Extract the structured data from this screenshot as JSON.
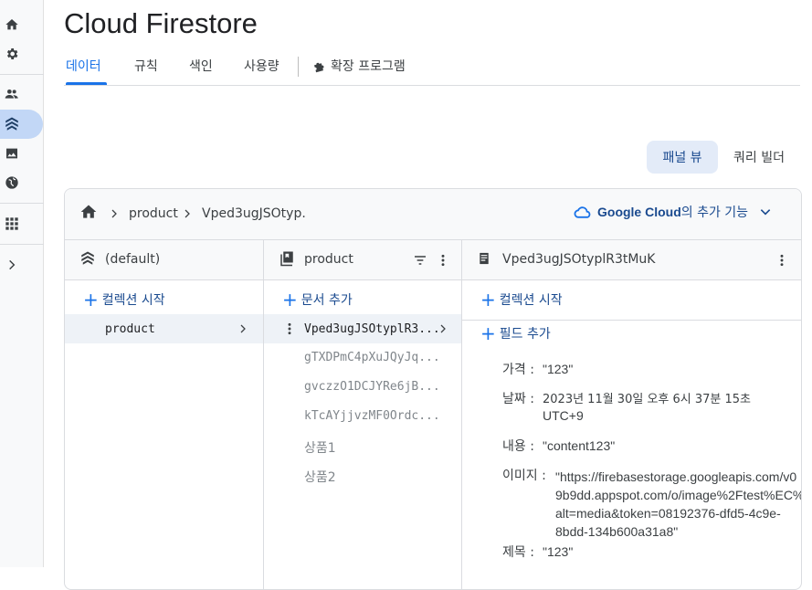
{
  "app": {
    "title": "Cloud Firestore"
  },
  "tabs": [
    {
      "label": "데이터",
      "active": true
    },
    {
      "label": "규칙"
    },
    {
      "label": "색인"
    },
    {
      "label": "사용량"
    },
    {
      "label": "확장 프로그램"
    }
  ],
  "view_toggle": {
    "panel_view": "패널 뷰",
    "query_builder": "쿼리 빌더"
  },
  "breadcrumb": {
    "collection": "product",
    "document": "Vped3ugJSOtyp."
  },
  "google_cloud": {
    "brand": "Google Cloud",
    "suffix": "의 추가 기능"
  },
  "col1": {
    "header": "(default)",
    "add_label": "컬렉션 시작",
    "items": [
      "product"
    ]
  },
  "col2": {
    "header": "product",
    "add_label": "문서 추가",
    "selected": "Vped3ugJSOtyplR3...",
    "items": [
      "gTXDPmC4pXuJQyJq...",
      "gvczzO1DCJYRe6jB...",
      "kTcAYjjvzMF0Ordc...",
      "상품1",
      "상품2"
    ]
  },
  "col3": {
    "header": "Vped3ugJSOtyplR3tMuK",
    "add_collection": "컬렉션 시작",
    "add_field": "필드 추가",
    "fields": [
      {
        "key": "가격 :",
        "value": "\"123\""
      },
      {
        "key": "날짜 :",
        "value_line1": "2023년 11월 30일 오후 6시 37분 15초",
        "value_line2": "UTC+9"
      },
      {
        "key": "내용 :",
        "value": "\"content123\""
      },
      {
        "key": "이미지 :",
        "value_line1": "\"https://firebasestorage.googleapis.com/v0",
        "value_line2": "9b9dd.appspot.com/o/image%2Ftest%EC%",
        "value_line3": "alt=media&token=08192376-dfd5-4c9e-",
        "value_line4": "8bdd-134b600a31a8\""
      },
      {
        "key": "제목 :",
        "value": "\"123\""
      }
    ]
  },
  "colors": {
    "accent": "#1a73e8",
    "rail_active": "#c2d7f6"
  }
}
